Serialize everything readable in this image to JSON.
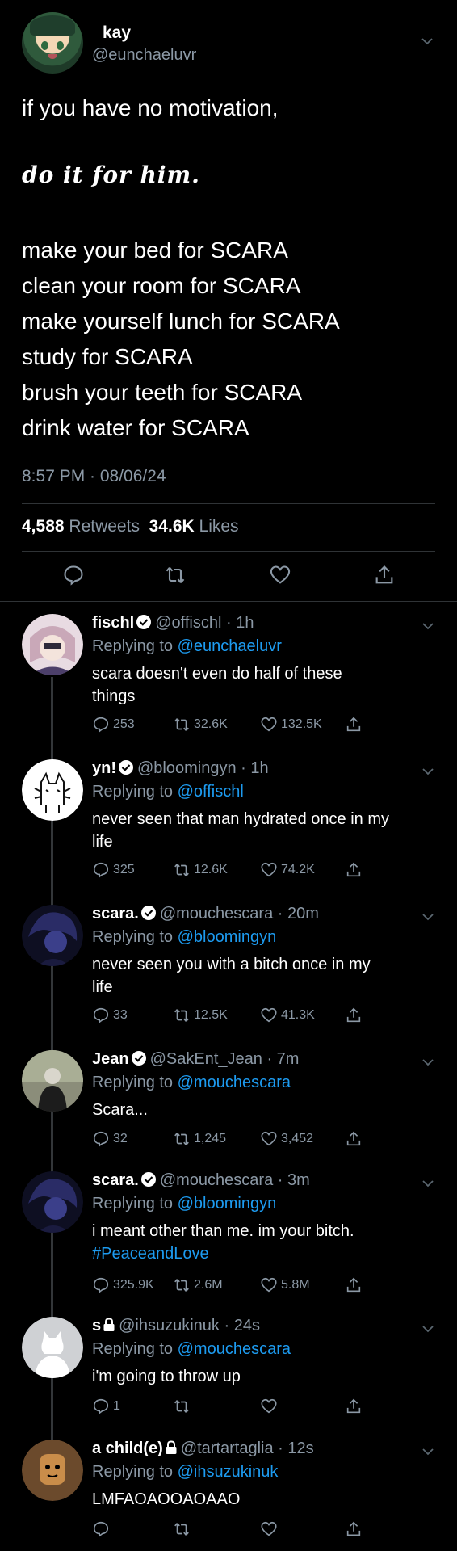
{
  "main_tweet": {
    "name": "kay",
    "handle": "@eunchaeluvr",
    "line1": "if you have no motivation,",
    "script_line": "do it for him.",
    "lines": [
      "make your bed for SCARA",
      "clean your room for SCARA",
      "make yourself lunch for SCARA",
      "study for SCARA",
      "brush your teeth for SCARA",
      "drink water for SCARA"
    ],
    "timestamp": "8:57 PM · 08/06/24",
    "retweets_count": "4,588",
    "retweets_label": "Retweets",
    "likes_count": "34.6K",
    "likes_label": "Likes"
  },
  "replies": [
    {
      "name": "fischl",
      "handle": "@offischl",
      "time": "· 1h",
      "replying_prefix": "Replying to",
      "replying_to": "@eunchaeluvr",
      "text_lines": [
        "scara doesn't even do half of these",
        "things"
      ],
      "replies": "253",
      "retweets": "32.6K",
      "likes": "132.5K"
    },
    {
      "name": "yn!",
      "handle": "@bloomingyn",
      "time": "· 1h",
      "replying_prefix": "Replying to",
      "replying_to": "@offischl",
      "text_lines": [
        "never seen that man hydrated once in my",
        "life"
      ],
      "replies": "325",
      "retweets": "12.6K",
      "likes": "74.2K"
    },
    {
      "name": "scara.",
      "handle": "@mouchescara",
      "time": "· 20m",
      "replying_prefix": "Replying to",
      "replying_to": "@bloomingyn",
      "text_lines": [
        "never seen you with a bitch once in my",
        "life"
      ],
      "replies": "33",
      "retweets": "12.5K",
      "likes": "41.3K"
    },
    {
      "name": "Jean",
      "handle": "@SakEnt_Jean",
      "time": "· 7m",
      "replying_prefix": "Replying to",
      "replying_to": "@mouchescara",
      "text_lines": [
        "Scara..."
      ],
      "replies": "32",
      "retweets": "1,245",
      "likes": "3,452"
    },
    {
      "name": "scara.",
      "handle": "@mouchescara",
      "time": "· 3m",
      "replying_prefix": "Replying to",
      "replying_to": "@bloomingyn",
      "text_lines": [
        "i meant other than me. im your bitch."
      ],
      "hashtag": "#PeaceandLove",
      "replies": "325.9K",
      "retweets": "2.6M",
      "likes": "5.8M"
    },
    {
      "name": "s",
      "handle": "@ihsuzukinuk",
      "time": "· 24s",
      "replying_prefix": "Replying to",
      "replying_to": "@mouchescara",
      "text_lines": [
        "i'm going to throw up"
      ],
      "replies": "1",
      "retweets": "",
      "likes": ""
    },
    {
      "name": "a child(e)",
      "handle": "@tartartaglia",
      "time": "· 12s",
      "replying_prefix": "Replying to",
      "replying_to": "@ihsuzukinuk",
      "text_lines": [
        "LMFAOAOOAOAAO"
      ],
      "replies": "",
      "retweets": "",
      "likes": ""
    }
  ],
  "colors": {
    "background": "#000000",
    "text": "#ffffff",
    "muted": "#8b98a5",
    "link": "#1d9bf0",
    "divider": "#2f3336"
  }
}
